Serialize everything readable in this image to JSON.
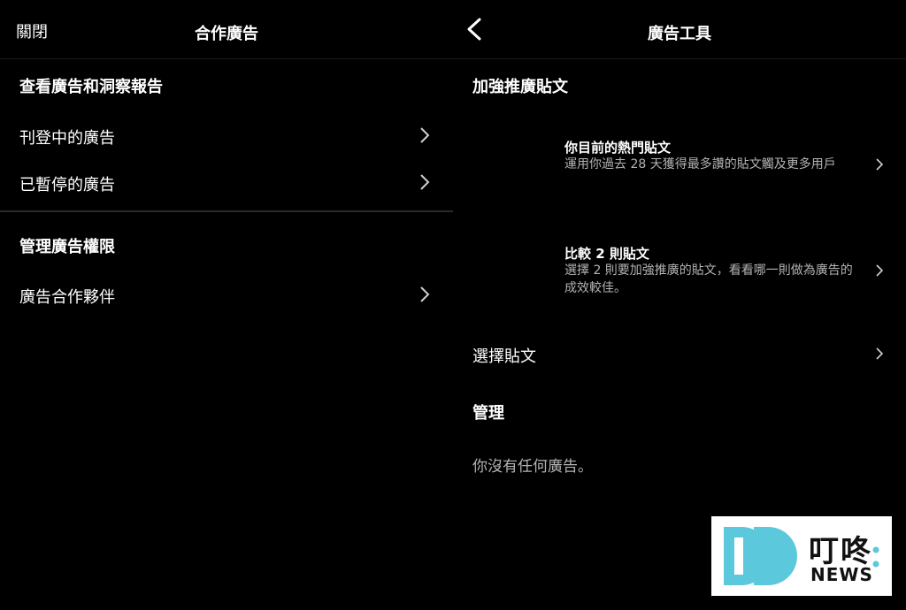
{
  "left": {
    "close_label": "關閉",
    "title": "合作廣告",
    "section1_title": "查看廣告和洞察報告",
    "section1_items": [
      "刊登中的廣告",
      "已暫停的廣告"
    ],
    "section2_title": "管理廣告權限",
    "section2_items": [
      "廣告合作夥伴"
    ]
  },
  "right": {
    "title": "廣告工具",
    "boost_title": "加強推廣貼文",
    "posts": [
      {
        "title": "你目前的熱門貼文",
        "desc": "運用你過去 28 天獲得最多讚的貼文觸及更多用戶"
      },
      {
        "title": "比較 2 則貼文",
        "desc": "選擇 2 則要加強推廣的貼文，看看哪一則做為廣告的成效較佳。"
      }
    ],
    "choose_post": "選擇貼文",
    "manage_title": "管理",
    "no_ads_text": "你沒有任何廣告。"
  },
  "watermark": {
    "title": "叮咚",
    "subtitle": "NEWS"
  },
  "colors": {
    "background": "#000000",
    "text": "#ffffff",
    "muted": "#b3b3b3",
    "logo_blue": "#5bc8dc"
  }
}
